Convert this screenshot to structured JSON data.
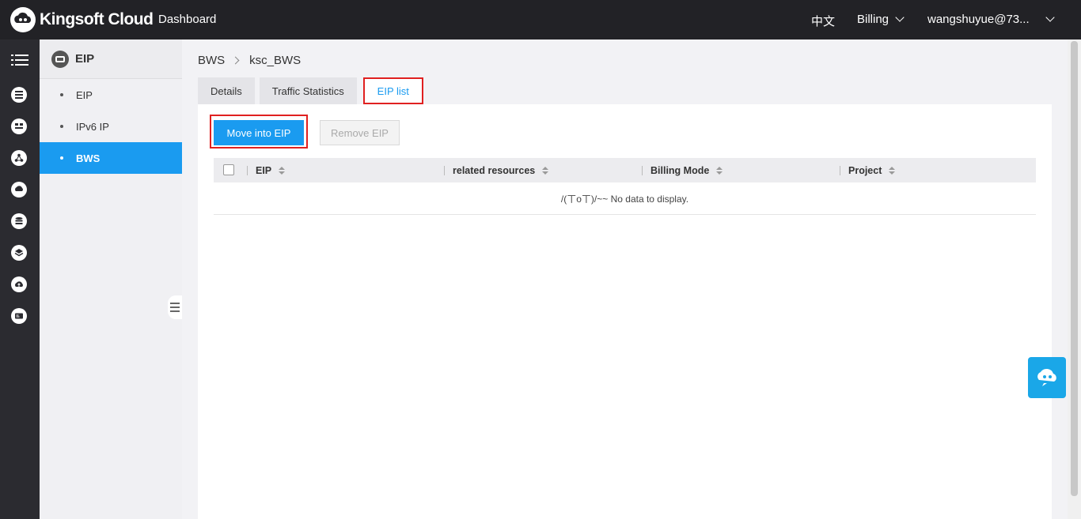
{
  "topbar": {
    "brand": "Kingsoft Cloud",
    "dashboard": "Dashboard",
    "lang": "中文",
    "billing": "Billing",
    "user": "wangshuyue@73..."
  },
  "sidenav": {
    "title": "EIP",
    "items": [
      {
        "label": "EIP",
        "active": false
      },
      {
        "label": "IPv6 IP",
        "active": false
      },
      {
        "label": "BWS",
        "active": true
      }
    ]
  },
  "rail": {
    "icons": [
      "menu-icon",
      "server-icon",
      "network-icon",
      "topology-icon",
      "cdn-icon",
      "database-icon",
      "layers-icon",
      "cloud-upload-icon",
      "id-card-icon"
    ]
  },
  "breadcrumb": {
    "root": "BWS",
    "current": "ksc_BWS"
  },
  "tabs": [
    {
      "label": "Details",
      "active": false
    },
    {
      "label": "Traffic Statistics",
      "active": false
    },
    {
      "label": "EIP list",
      "active": true
    }
  ],
  "actions": {
    "move_into": "Move into EIP",
    "remove": "Remove EIP"
  },
  "table": {
    "columns": [
      "EIP",
      "related resources",
      "Billing Mode",
      "Project"
    ],
    "empty_text": "/(ㄒoㄒ)/~~ No data to display."
  },
  "colors": {
    "accent": "#1a9bf0",
    "highlight": "#e02020",
    "topbar": "#222226"
  }
}
